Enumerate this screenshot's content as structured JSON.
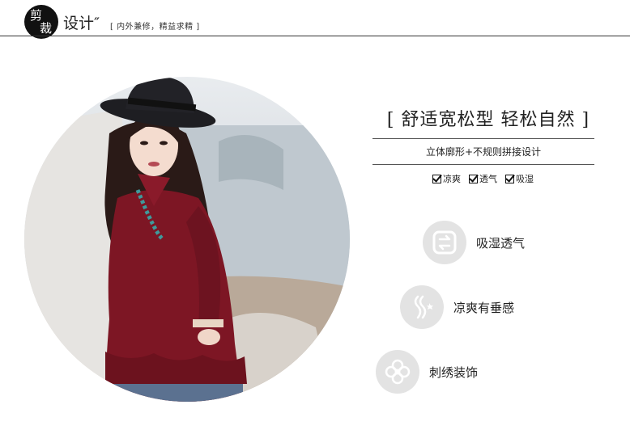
{
  "header": {
    "badge_char_1": "剪",
    "badge_char_2": "裁",
    "title": "设计″",
    "slogan": "[ 内外兼修，精益求精 ]"
  },
  "main": {
    "headline": "[ 舒适宽松型 轻松自然 ]",
    "subheadline": "立体廓形+不规则拼接设计",
    "features": [
      {
        "label": "凉爽"
      },
      {
        "label": "透气"
      },
      {
        "label": "吸湿"
      }
    ],
    "attributes": [
      {
        "label": "吸湿透气",
        "icon": "exchange-arrows-icon"
      },
      {
        "label": "凉爽有垂感",
        "icon": "breeze-icon"
      },
      {
        "label": "刺绣装饰",
        "icon": "flower-embroidery-icon"
      }
    ]
  },
  "colors": {
    "shirt": "#7d1624",
    "icon_bg": "#e3e3e3",
    "text": "#222222"
  }
}
